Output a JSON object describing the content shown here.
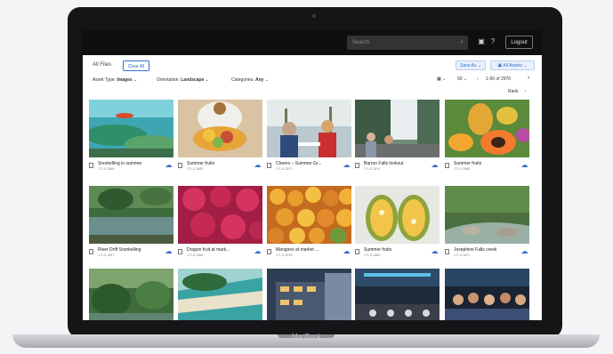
{
  "device": {
    "brand": "MacBook"
  },
  "topbar": {
    "search_placeholder": "Search",
    "search_icon": "magnifier-icon",
    "cart_icon": "cart-icon",
    "help_icon": "help-icon",
    "logout_label": "Logout"
  },
  "toolbar": {
    "section_title": "All Files",
    "clear_all_label": "Clear All",
    "save_as_label": "Save As ⌄",
    "all_assets_label": "▣ All Assets ⌄"
  },
  "filters": {
    "asset_type": {
      "label": "Asset Type:",
      "value": "Images"
    },
    "orientation": {
      "label": "Orientation:",
      "value": "Landscape"
    },
    "categories": {
      "label": "Categories:",
      "value": "Any"
    }
  },
  "pagination": {
    "view_icon": "grid-view-icon",
    "per_page": "50",
    "range_text": "1-50 of 2970"
  },
  "sort": {
    "label": "Rank",
    "direction_icon": "arrow-up-icon"
  },
  "assets": [
    {
      "title": "Snorkelling in summer",
      "id": "171-S-3868",
      "scene": "reef"
    },
    {
      "title": "Summer fruits",
      "id": "171-S-3880",
      "scene": "fruit-bowl"
    },
    {
      "title": "Cheers – Summer Gr...",
      "id": "171-S-3872",
      "scene": "cafe"
    },
    {
      "title": "Barron Falls lookout",
      "id": "171-S-3879",
      "scene": "falls"
    },
    {
      "title": "Summer fruits",
      "id": "171-S-3888",
      "scene": "papaya"
    },
    {
      "title": "River Drift Snorkelling",
      "id": "171-S-3867",
      "scene": "river"
    },
    {
      "title": "Dragon fruit at mark...",
      "id": "171-S-3866",
      "scene": "dragonfruit"
    },
    {
      "title": "Mangoes at market ...",
      "id": "171-S-3878",
      "scene": "mangoes"
    },
    {
      "title": "Summer fruits",
      "id": "171-S-3885",
      "scene": "jackfruit"
    },
    {
      "title": "Josephine Falls creek",
      "id": "171-S-3871",
      "scene": "creek"
    },
    {
      "title": "",
      "id": "",
      "scene": "rainforest"
    },
    {
      "title": "",
      "id": "",
      "scene": "beach"
    },
    {
      "title": "",
      "id": "",
      "scene": "building"
    },
    {
      "title": "",
      "id": "",
      "scene": "hall"
    },
    {
      "title": "",
      "id": "",
      "scene": "crowd"
    }
  ]
}
